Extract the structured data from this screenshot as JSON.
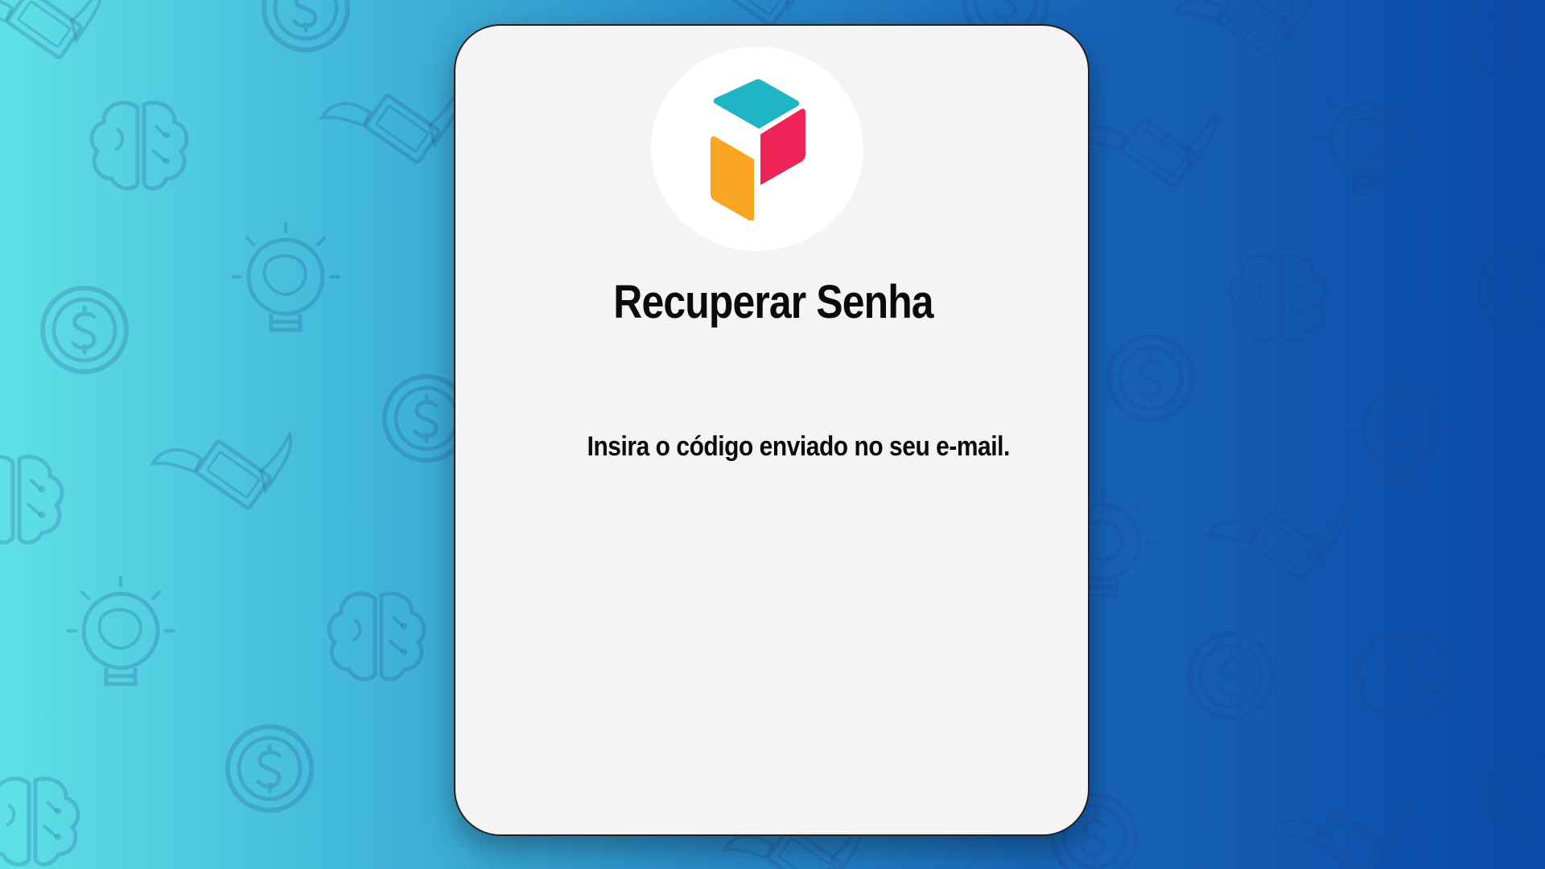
{
  "page": {
    "title": "Recuperar Senha",
    "instruction": "Insira o código enviado no seu e-mail."
  },
  "icons": {
    "logo": "cube-logo-icon",
    "pattern": [
      "coin-icon",
      "brain-icon",
      "lightbulb-brain-icon",
      "flying-money-icon"
    ]
  },
  "colors": {
    "background_start": "#5fe0e6",
    "background_end": "#0a4aa8",
    "card_background": "#f4f4f4",
    "logo_teal": "#1fb5c4",
    "logo_pink": "#ee2356",
    "logo_orange": "#f9a521",
    "text": "#0a0a0a"
  }
}
